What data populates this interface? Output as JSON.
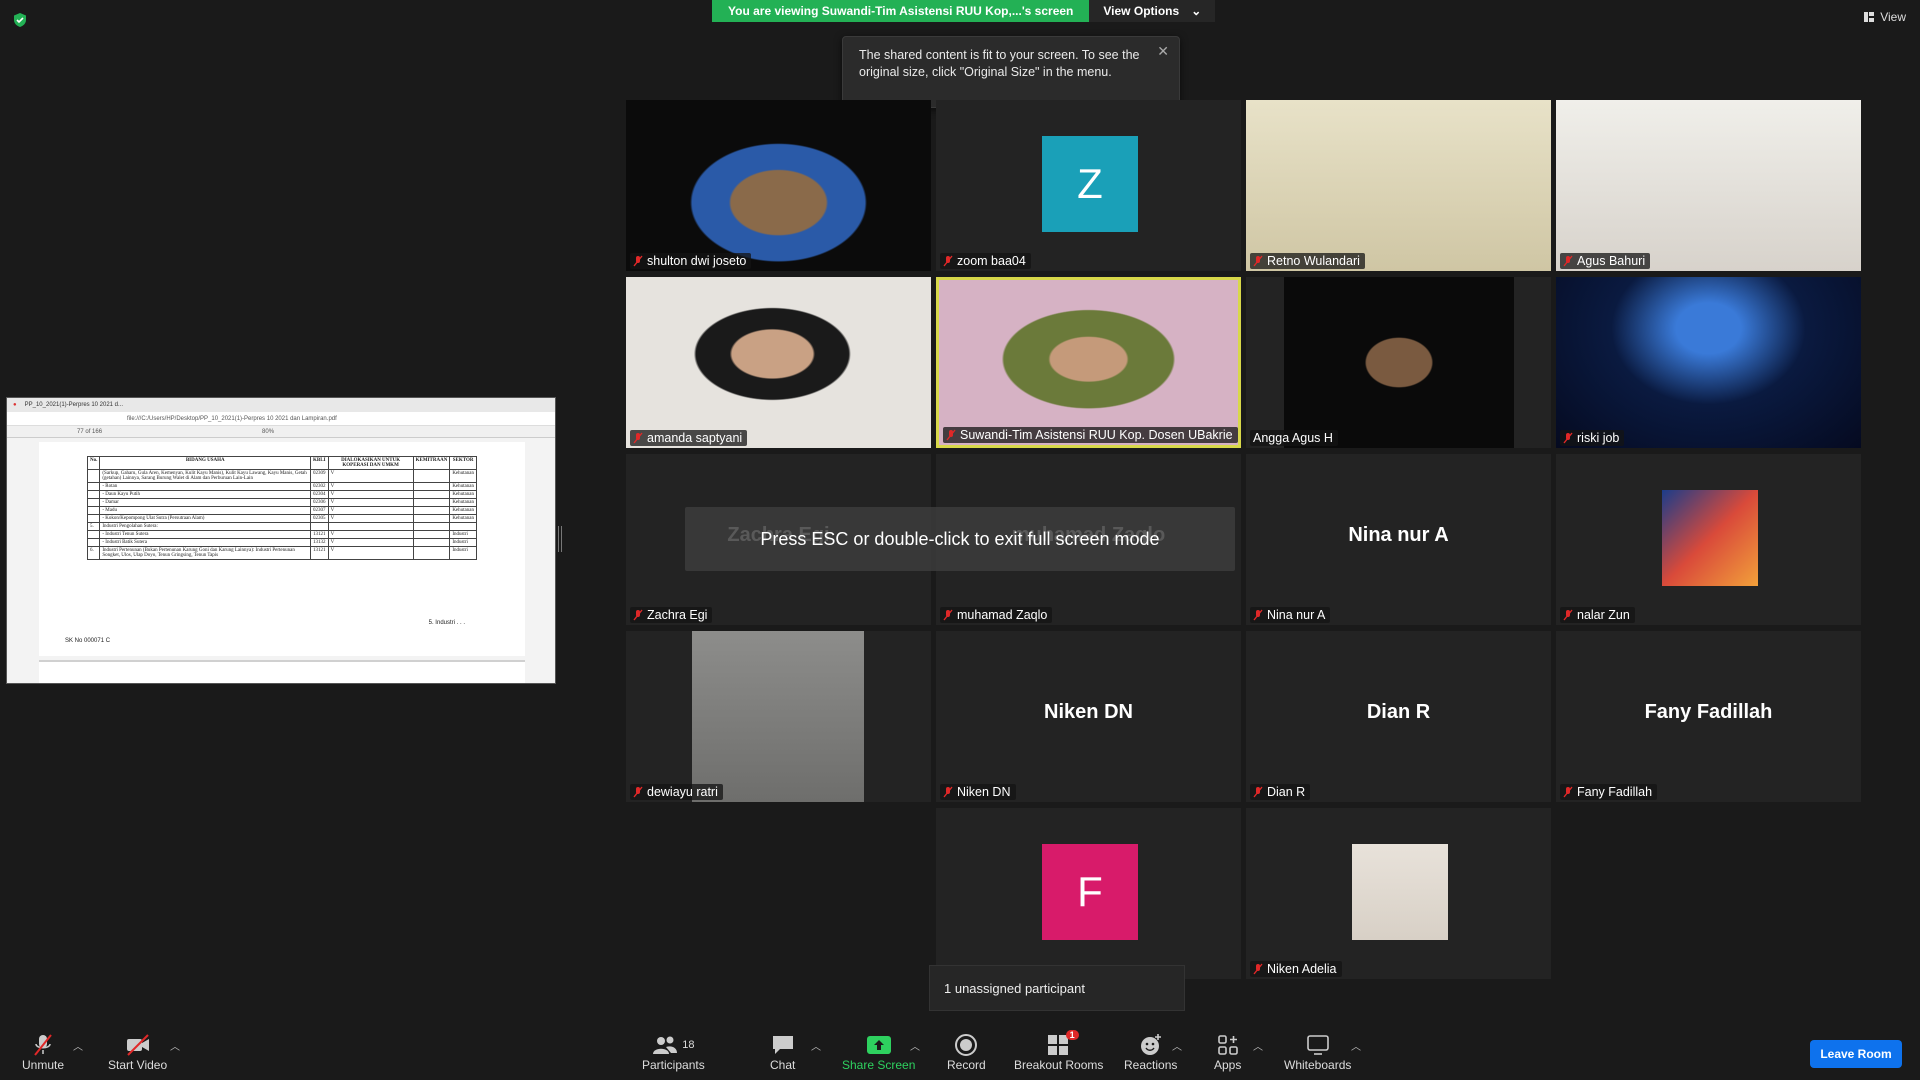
{
  "top": {
    "banner_text": "You are viewing Suwandi-Tim Asistensi RUU Kop,...'s screen",
    "view_options": "View Options",
    "view_label": "View"
  },
  "tooltip": {
    "text": "The shared content is fit to your screen. To see the original size, click \"Original Size\" in the menu."
  },
  "shared_screen": {
    "tab_title": "PP_10_2021(1)-Perpres 10 2021 d...",
    "url": "file:///C:/Users/HP/Desktop/PP_10_2021(1)-Perpres 10 2021 dan Lampiran.pdf",
    "page": "77",
    "page_total": "of 166",
    "zoom": "80%",
    "table_headers": [
      "No.",
      "BIDANG USAHA",
      "KBLI",
      "DIALOKASIKAN UNTUK KOPERASI DAN UMKM",
      "KEMITRAAN",
      "SEKTOR"
    ],
    "rows": [
      [
        "",
        "(Sarkup, Gaharu, Gula Aren, Kemenyan, Kulit Kayu Manis), Kulit Kayu Lawang, Kayu Manis, Getah (getahan) Lainnya, Sarang Burung Walet di Alam dan Perburuan Lain-Lain",
        "02309",
        "V",
        "",
        "Kehutanan"
      ],
      [
        "",
        "- Rotan",
        "02302",
        "V",
        "",
        "Kehutanan"
      ],
      [
        "",
        "- Daun Kayu Putih",
        "02304",
        "V",
        "",
        "Kehutanan"
      ],
      [
        "",
        "- Damar",
        "02306",
        "V",
        "",
        "Kehutanan"
      ],
      [
        "",
        "- Madu",
        "02307",
        "V",
        "",
        "Kehutanan"
      ],
      [
        "",
        "- Kokon/Kepompong Ulat Sutra (Persutraan Alam)",
        "02305",
        "V",
        "",
        "Kehutanan"
      ],
      [
        "5.",
        "Industri Pengolahan Sutera:",
        "",
        "",
        "",
        ""
      ],
      [
        "",
        "- Industri Tenun Sutera",
        "13121",
        "V",
        "",
        "Industri"
      ],
      [
        "",
        "- Industri Batik Sutera",
        "13132",
        "V",
        "",
        "Industri"
      ],
      [
        "6.",
        "Industri Pertenunan (Bukan Pertenunan Karung Goni dan Karung Lainnya): Industri Pertenunan Songket, Ulos, Ulap Doyo, Tenun Gringsing, Tenun Tapis",
        "13121",
        "V",
        "",
        "Industri"
      ]
    ],
    "next_text": "5. Industri . . .",
    "sk_text": "SK No 000071 C"
  },
  "participants": [
    {
      "name": "shulton dwi joseto",
      "type": "video",
      "avatar": ""
    },
    {
      "name": "zoom baa04",
      "type": "avatar",
      "avatar": "Z",
      "color": "#1aa0b8"
    },
    {
      "name": "Retno Wulandari",
      "type": "video",
      "avatar": ""
    },
    {
      "name": "Agus Bahuri",
      "type": "video",
      "avatar": ""
    },
    {
      "name": "amanda saptyani",
      "type": "video",
      "avatar": ""
    },
    {
      "name": "Suwandi-Tim Asistensi RUU Kop. Dosen UBakrie",
      "type": "video",
      "avatar": ""
    },
    {
      "name": "Angga Agus H",
      "type": "video",
      "avatar": ""
    },
    {
      "name": "riski job",
      "type": "video",
      "avatar": ""
    },
    {
      "name": "Zachra Egi",
      "type": "text",
      "bigname": "Zachra Egi"
    },
    {
      "name": "muhamad Zaqlo",
      "type": "text",
      "bigname": "muhamad Zaqlo"
    },
    {
      "name": "Nina nur A",
      "type": "text",
      "bigname": "Nina nur A"
    },
    {
      "name": "nalar Zun",
      "type": "image",
      "avatar": ""
    },
    {
      "name": "dewiayu ratri",
      "type": "video",
      "avatar": ""
    },
    {
      "name": "Niken DN",
      "type": "text",
      "bigname": "Niken DN"
    },
    {
      "name": "Dian R",
      "type": "text",
      "bigname": "Dian R"
    },
    {
      "name": "Fany Fadillah",
      "type": "text",
      "bigname": "Fany Fadillah"
    },
    {
      "name": "",
      "type": "avatar",
      "avatar": "F",
      "color": "#d81b6a"
    },
    {
      "name": "Niken Adelia",
      "type": "image",
      "avatar": ""
    }
  ],
  "esc_message": "Press ESC or double-click to exit full screen mode",
  "unassigned": "1 unassigned participant",
  "toolbar": {
    "unmute": "Unmute",
    "start_video": "Start Video",
    "participants": "Participants",
    "participants_count": "18",
    "chat": "Chat",
    "share_screen": "Share Screen",
    "record": "Record",
    "breakout_rooms": "Breakout Rooms",
    "breakout_badge": "1",
    "reactions": "Reactions",
    "apps": "Apps",
    "whiteboards": "Whiteboards",
    "leave": "Leave Room"
  },
  "colors": {
    "banner_green": "#23b155",
    "active_speaker": "#d8d84a",
    "leave_blue": "#0e72ed",
    "muted_red": "#e02828"
  }
}
